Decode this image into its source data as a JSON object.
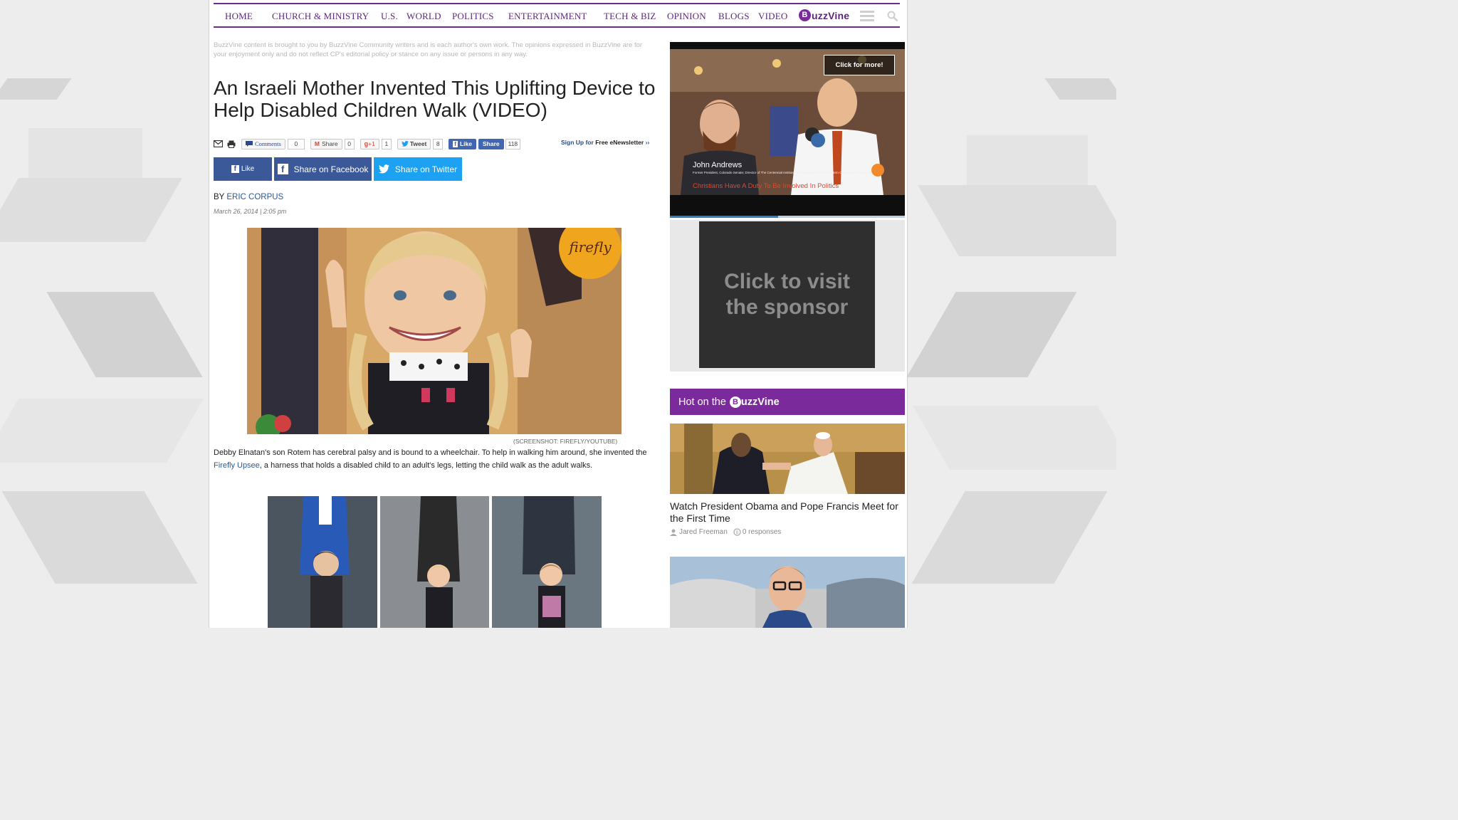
{
  "nav": {
    "items": [
      "HOME",
      "CHURCH & MINISTRY",
      "U.S.",
      "WORLD",
      "POLITICS",
      "ENTERTAINMENT",
      "TECH & BIZ",
      "OPINION",
      "BLOGS",
      "VIDEO"
    ],
    "logo_letter": "B",
    "logo_text": "uzzVine"
  },
  "disclaimer": "BuzzVine content is brought to you by BuzzVine Community writers and is each author's own work. The opinions expressed in BuzzVine are for your enjoyment only and do not reflect CP's editorial policy or stance on any issue or persons in any way.",
  "article": {
    "headline": "An Israeli Mother Invented This Uplifting Device to Help Disabled Children Walk (VIDEO)",
    "byline_prefix": "BY",
    "author": "ERIC CORPUS",
    "date": "March 26, 2014 | 2:05 pm",
    "caption": "(SCREENSHOT: FIREFLY/YOUTUBE)",
    "para_part1": "Debby Elnatan's son Rotem has cerebral palsy and is bound to a wheelchair. To help in walking him around, she invented the ",
    "para_link": "Firefly Upsee",
    "para_part2": ", a harness that holds a disabled child to an adult's legs, letting the child walk as the adult walks.",
    "photo1_watermark": "firefly"
  },
  "share_row": {
    "comments_label": "Comments",
    "comments_count": "0",
    "share_label": "Share",
    "share_count": "0",
    "gplus_label": "+1",
    "gplus_count": "1",
    "tweet_label": "Tweet",
    "tweet_count": "8",
    "fb_like_label": "Like",
    "fb_share_label": "Share",
    "fb_count": "118",
    "newsletter_prefix": "Sign Up for",
    "newsletter_bold": "Free eNewsletter",
    "newsletter_suffix": "››"
  },
  "big_share": {
    "like_label": "Like",
    "facebook_label": "Share on Facebook",
    "twitter_label": "Share on Twitter"
  },
  "video_ad": {
    "click_label": "Click for more!",
    "person_name": "John Andrews",
    "person_title": "Former President, Colorado Senate; Director of The Centennial Institute, and organizer of The Western Conservative Summit",
    "banner_text": "Christians Have A Duty To Be Involved In Politics",
    "progress": 0.46
  },
  "sponsor": {
    "line1": "Click to visit",
    "line2": "the sponsor"
  },
  "hot": {
    "header_prefix": "Hot on the",
    "logo_letter": "B",
    "logo_text": "uzzVine",
    "story_title": "Watch President Obama and Pope Francis Meet for the First Time",
    "author": "Jared Freeman",
    "responses": "0 responses"
  },
  "colors": {
    "brand_purple": "#7a2a9a",
    "facebook_blue": "#3b5998",
    "twitter_blue": "#1da1f2",
    "link_blue": "#2a5a9a"
  }
}
